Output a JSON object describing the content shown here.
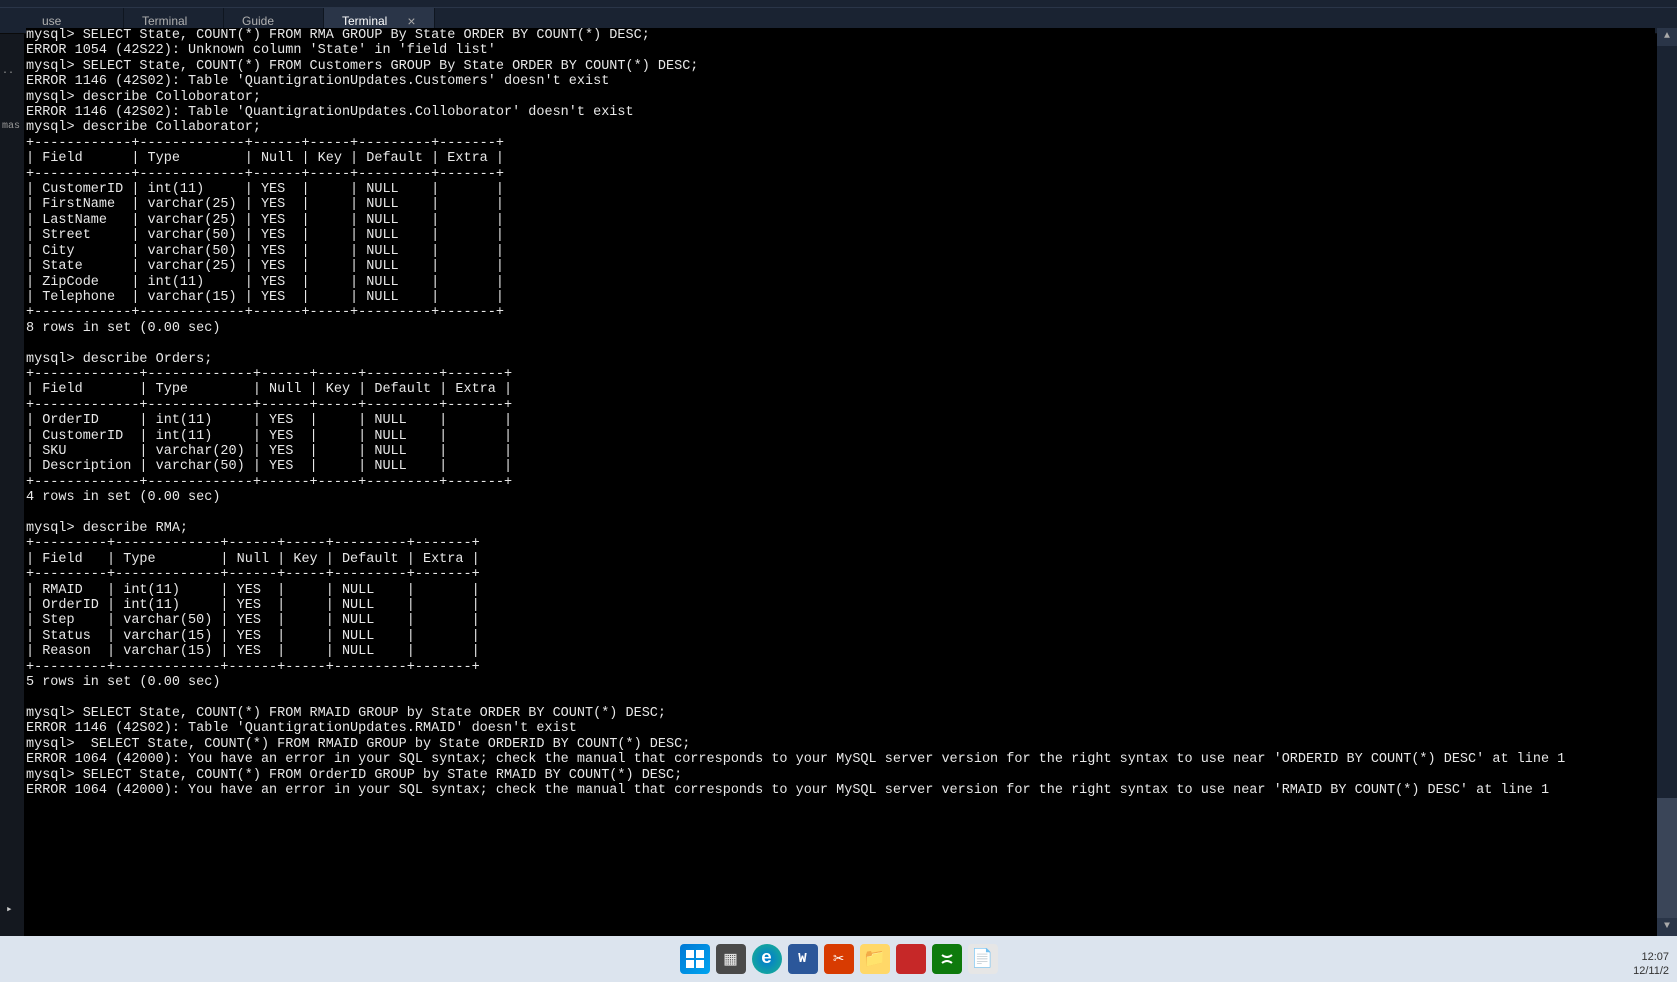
{
  "tabs": [
    {
      "label": "use",
      "active": false
    },
    {
      "label": "Terminal",
      "active": false
    },
    {
      "label": "Guide",
      "active": false
    },
    {
      "label": "Terminal",
      "active": true
    }
  ],
  "gutter": {
    "text1": "..",
    "text2": "mas",
    "arrow": "▸"
  },
  "terminal_lines": [
    "mysql> SELECT State, COUNT(*) FROM RMA GROUP By State ORDER BY COUNT(*) DESC;",
    "ERROR 1054 (42S22): Unknown column 'State' in 'field list'",
    "mysql> SELECT State, COUNT(*) FROM Customers GROUP By State ORDER BY COUNT(*) DESC;",
    "ERROR 1146 (42S02): Table 'QuantigrationUpdates.Customers' doesn't exist",
    "mysql> describe Colloborator;",
    "ERROR 1146 (42S02): Table 'QuantigrationUpdates.Colloborator' doesn't exist",
    "mysql> describe Collaborator;",
    "+------------+-------------+------+-----+---------+-------+",
    "| Field      | Type        | Null | Key | Default | Extra |",
    "+------------+-------------+------+-----+---------+-------+",
    "| CustomerID | int(11)     | YES  |     | NULL    |       |",
    "| FirstName  | varchar(25) | YES  |     | NULL    |       |",
    "| LastName   | varchar(25) | YES  |     | NULL    |       |",
    "| Street     | varchar(50) | YES  |     | NULL    |       |",
    "| City       | varchar(50) | YES  |     | NULL    |       |",
    "| State      | varchar(25) | YES  |     | NULL    |       |",
    "| ZipCode    | int(11)     | YES  |     | NULL    |       |",
    "| Telephone  | varchar(15) | YES  |     | NULL    |       |",
    "+------------+-------------+------+-----+---------+-------+",
    "8 rows in set (0.00 sec)",
    "",
    "mysql> describe Orders;",
    "+-------------+-------------+------+-----+---------+-------+",
    "| Field       | Type        | Null | Key | Default | Extra |",
    "+-------------+-------------+------+-----+---------+-------+",
    "| OrderID     | int(11)     | YES  |     | NULL    |       |",
    "| CustomerID  | int(11)     | YES  |     | NULL    |       |",
    "| SKU         | varchar(20) | YES  |     | NULL    |       |",
    "| Description | varchar(50) | YES  |     | NULL    |       |",
    "+-------------+-------------+------+-----+---------+-------+",
    "4 rows in set (0.00 sec)",
    "",
    "mysql> describe RMA;",
    "+---------+-------------+------+-----+---------+-------+",
    "| Field   | Type        | Null | Key | Default | Extra |",
    "+---------+-------------+------+-----+---------+-------+",
    "| RMAID   | int(11)     | YES  |     | NULL    |       |",
    "| OrderID | int(11)     | YES  |     | NULL    |       |",
    "| Step    | varchar(50) | YES  |     | NULL    |       |",
    "| Status  | varchar(15) | YES  |     | NULL    |       |",
    "| Reason  | varchar(15) | YES  |     | NULL    |       |",
    "+---------+-------------+------+-----+---------+-------+",
    "5 rows in set (0.00 sec)",
    "",
    "mysql> SELECT State, COUNT(*) FROM RMAID GROUP by State ORDER BY COUNT(*) DESC;",
    "ERROR 1146 (42S02): Table 'QuantigrationUpdates.RMAID' doesn't exist",
    "mysql>  SELECT State, COUNT(*) FROM RMAID GROUP by State ORDERID BY COUNT(*) DESC;",
    "ERROR 1064 (42000): You have an error in your SQL syntax; check the manual that corresponds to your MySQL server version for the right syntax to use near 'ORDERID BY COUNT(*) DESC' at line 1",
    "mysql> SELECT State, COUNT(*) FROM OrderID GROUP by STate RMAID BY COUNT(*) DESC;",
    "ERROR 1064 (42000): You have an error in your SQL syntax; check the manual that corresponds to your MySQL server version for the right syntax to use near 'RMAID BY COUNT(*) DESC' at line 1"
  ],
  "scrollbar": {
    "up": "▲",
    "down": "▼"
  },
  "taskbar": {
    "icons": [
      {
        "name": "start",
        "glyph": "⊞"
      },
      {
        "name": "calculator",
        "glyph": "🖩"
      },
      {
        "name": "edge",
        "glyph": "e"
      },
      {
        "name": "word",
        "glyph": "W"
      },
      {
        "name": "snip",
        "glyph": "✂"
      },
      {
        "name": "explorer",
        "glyph": "📁"
      },
      {
        "name": "app-red",
        "glyph": ""
      },
      {
        "name": "xbox",
        "glyph": "✕"
      },
      {
        "name": "notepad",
        "glyph": "📝"
      }
    ]
  },
  "clock": {
    "time": "12:07",
    "date": "12/11/2"
  }
}
